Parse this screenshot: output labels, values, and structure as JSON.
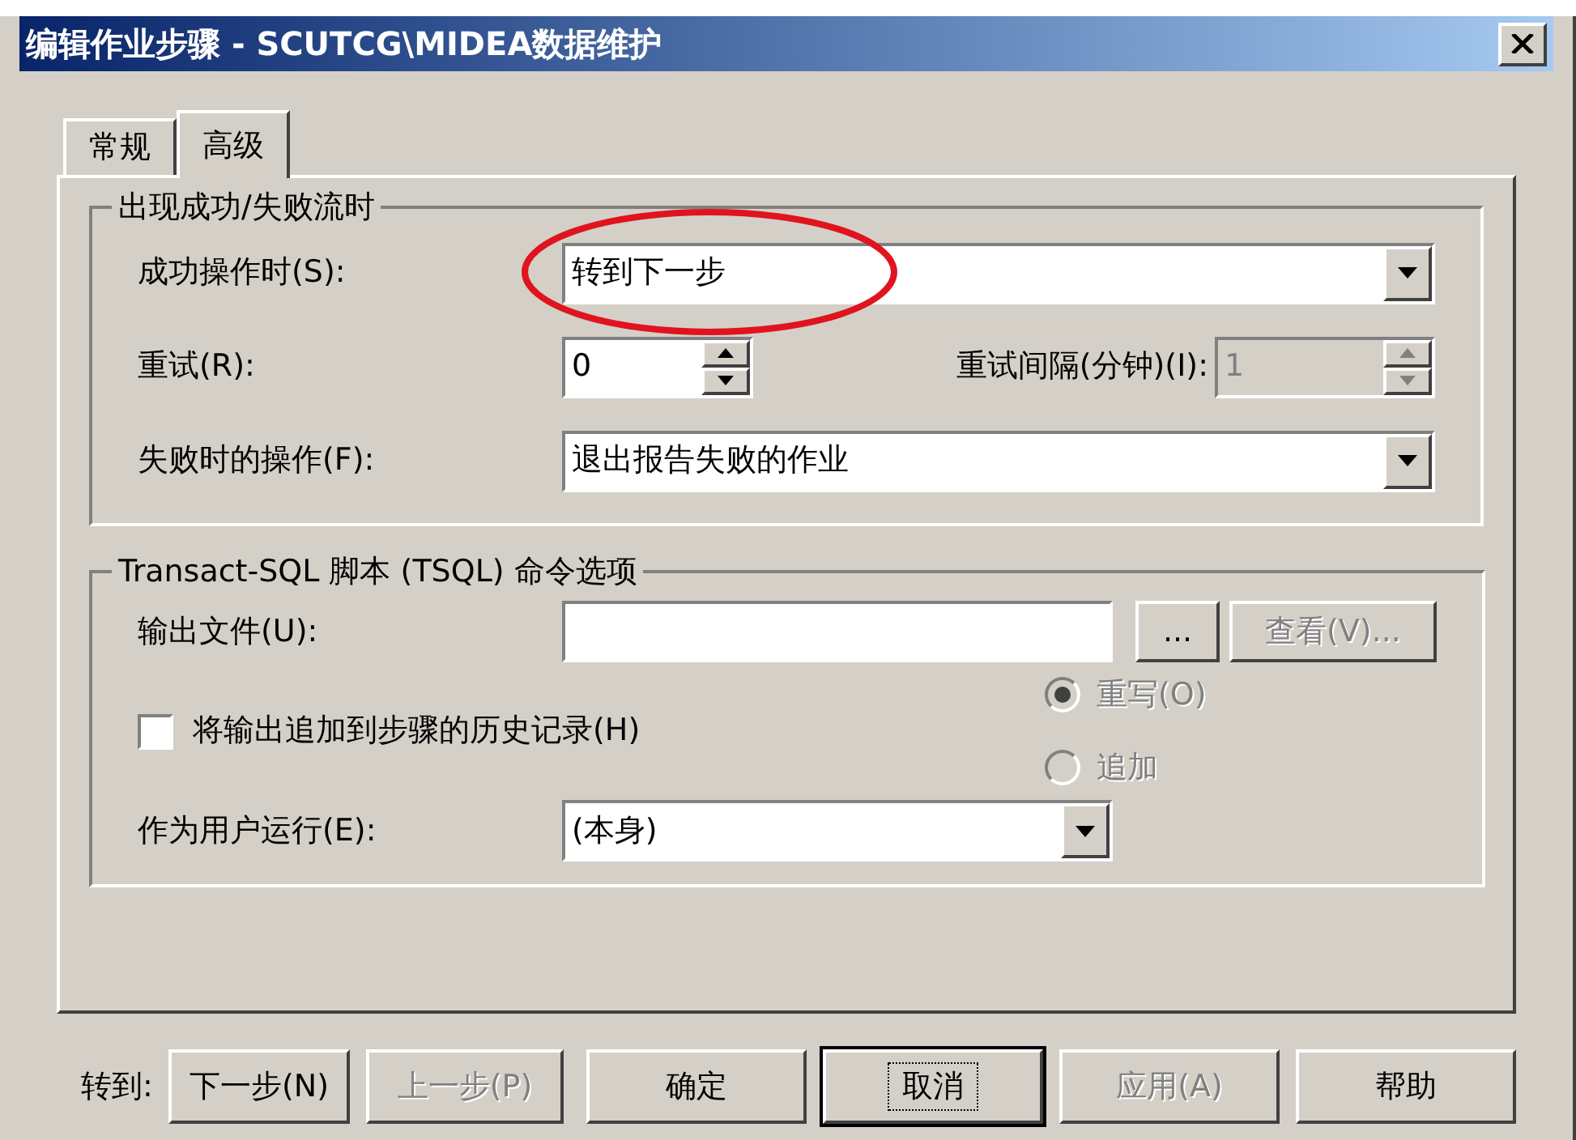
{
  "window": {
    "title": "编辑作业步骤 - SCUTCG\\MIDEA数据维护"
  },
  "tabs": [
    {
      "label": "常规",
      "selected": false
    },
    {
      "label": "高级",
      "selected": true
    }
  ],
  "flow_group": {
    "title": "出现成功/失败流时",
    "on_success": {
      "label": "成功操作时(S):",
      "value": "转到下一步",
      "circled": true
    },
    "retry": {
      "label": "重试(R):",
      "value": "0",
      "disabled": false
    },
    "retry_interval": {
      "label": "重试间隔(分钟)(I):",
      "value": "1",
      "disabled": true
    },
    "on_failure": {
      "label": "失败时的操作(F):",
      "value": "退出报告失败的作业"
    }
  },
  "tsql_group": {
    "title": "Transact-SQL 脚本 (TSQL) 命令选项",
    "output_file": {
      "label": "输出文件(U):"
    },
    "browse_button": {
      "label": "...",
      "disabled": false
    },
    "view_button": {
      "label": "查看(V)...",
      "disabled": true
    },
    "append_checkbox": {
      "label": "将输出追加到步骤的历史记录(H)",
      "checked": false
    },
    "radios": [
      {
        "label": "重写(O)",
        "selected": true,
        "disabled": true
      },
      {
        "label": "追加",
        "selected": false,
        "disabled": true
      }
    ],
    "run_as": {
      "label": "作为用户运行(E):",
      "value": "(本身)"
    }
  },
  "footer": {
    "goto_label": "转到:",
    "buttons": [
      {
        "label": "下一步(N)",
        "disabled": false,
        "focused": false
      },
      {
        "label": "上一步(P)",
        "disabled": true,
        "focused": false
      },
      {
        "label": "确定",
        "disabled": false,
        "focused": false
      },
      {
        "label": "取消",
        "disabled": false,
        "focused": true
      },
      {
        "label": "应用(A)",
        "disabled": true,
        "focused": false
      },
      {
        "label": "帮助",
        "disabled": false,
        "focused": false
      }
    ]
  }
}
